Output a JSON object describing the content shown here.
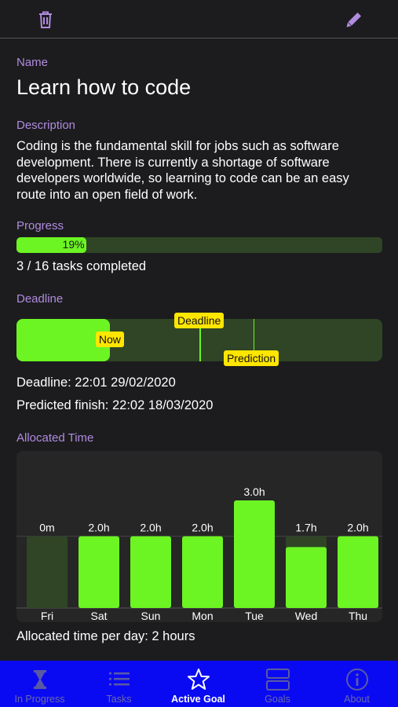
{
  "toolbar": {
    "delete_icon": "trash-icon",
    "edit_icon": "pencil-icon"
  },
  "name": {
    "label": "Name",
    "value": "Learn how to code"
  },
  "description": {
    "label": "Description",
    "lines": [
      "Coding is the fundamental skill for jobs such as software",
      "development. There is currently a shortage of software",
      "developers worldwide, so learning to code can be an easy",
      "route into an open field of work."
    ]
  },
  "progress": {
    "label": "Progress",
    "percent": 19,
    "percent_text": "19%",
    "summary": "3 / 16 tasks completed"
  },
  "deadline": {
    "label": "Deadline",
    "now_fraction": 0.255,
    "deadline_fraction": 0.5,
    "prediction_fraction": 0.648,
    "now_tag": "Now",
    "deadline_tag": "Deadline",
    "prediction_tag": "Prediction",
    "deadline_text": "Deadline: 22:01 29/02/2020",
    "predicted_text": "Predicted finish: 22:02 18/03/2020",
    "colors": {
      "fill": "#6cf423",
      "track": "#2f4525",
      "tag": "#ffe600"
    }
  },
  "allocated": {
    "label": "Allocated Time",
    "footer": "Allocated time per day: 2 hours"
  },
  "chart_data": {
    "type": "bar",
    "categories": [
      "Fri",
      "Sat",
      "Sun",
      "Mon",
      "Tue",
      "Wed",
      "Thu"
    ],
    "values": [
      0,
      2.0,
      2.0,
      2.0,
      3.0,
      1.7,
      2.0
    ],
    "data_labels": [
      "0m",
      "2.0h",
      "2.0h",
      "2.0h",
      "3.0h",
      "1.7h",
      "2.0h"
    ],
    "target": 2.0,
    "ylim": [
      0,
      3.0
    ],
    "colors": {
      "bar": "#6cf423",
      "target_bg": "#2f4525"
    }
  },
  "tabs": [
    {
      "label": "In Progress",
      "icon": "hourglass-icon",
      "active": false
    },
    {
      "label": "Tasks",
      "icon": "list-icon",
      "active": false
    },
    {
      "label": "Active Goal",
      "icon": "star-icon",
      "active": true
    },
    {
      "label": "Goals",
      "icon": "stack-icon",
      "active": false
    },
    {
      "label": "About",
      "icon": "info-icon",
      "active": false
    }
  ]
}
